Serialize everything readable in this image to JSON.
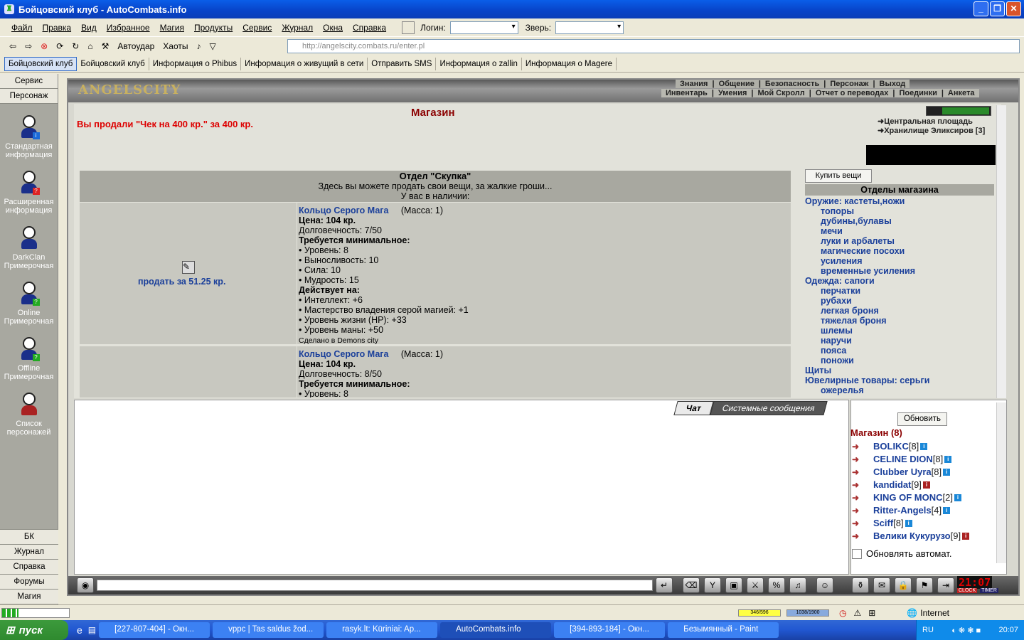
{
  "window": {
    "title": "Бойцовский клуб - AutoCombats.info"
  },
  "menu": [
    "Файл",
    "Правка",
    "Вид",
    "Избранное",
    "Магия",
    "Продукты",
    "Сервис",
    "Журнал",
    "Окна",
    "Справка"
  ],
  "menu_fields": {
    "login_label": "Логин:",
    "pet_label": "Зверь:"
  },
  "toolbar": {
    "autostrike": "Автоудар",
    "chaots": "Хаоты",
    "address": "http://angelscity.combats.ru/enter.pl"
  },
  "favorites": [
    "Бойцовский клуб",
    "Бойцовский клуб",
    "Информация о Phibus",
    "Информация о живущий в сети",
    "Отправить SMS",
    "Информация о zallin",
    "Информация о Magere"
  ],
  "left_panel": {
    "top": [
      "Сервис",
      "Персонаж"
    ],
    "items": [
      "Стандартная информация",
      "Расширенная информация",
      "DarkClan Примерочная",
      "Online Примерочная",
      "Offline Примерочная",
      "Список персонажей"
    ],
    "bottom": [
      "БК",
      "Журнал",
      "Справка",
      "Форумы",
      "Магия"
    ]
  },
  "game": {
    "logo": "ANGELSCITY",
    "nav_row1": [
      "Знания",
      "Общение",
      "Безопасность",
      "Персонаж",
      "Выход"
    ],
    "nav_row2": [
      "Инвентарь",
      "Умения",
      "Мой Скролл",
      "Отчет о переводах",
      "Поединки",
      "Анкета"
    ]
  },
  "shop": {
    "title": "Магазин",
    "sold_msg": "Вы продали \"Чек на 400 кр.\" за 400 кр.",
    "dept_title": "Отдел \"Скупка\"",
    "dept_desc": "Здесь вы можете продать свои вещи, за жалкие гроши...",
    "dept_have": "У вас в наличии:",
    "items": [
      {
        "name": "Кольцо Серого Мага",
        "mass": "(Масса: 1)",
        "price": "Цена: 104 кр.",
        "durability": "Долговечность: 7/50",
        "req_title": "Требуется минимальное:",
        "reqs": [
          "• Уровень: 8",
          "• Выносливость: 10",
          "• Сила: 10",
          "• Мудрость: 15"
        ],
        "acts_title": "Действует на:",
        "acts": [
          "• Интеллект: +6",
          "• Мастерство владения серой магией: +1",
          "• Уровень жизни (HP): +33",
          "• Уровень маны: +50"
        ],
        "made": "Сделано в Demons city",
        "sell": "продать за 51.25 кр."
      },
      {
        "name": "Кольцо Серого Мага",
        "mass": "(Масса: 1)",
        "price": "Цена: 104 кр.",
        "durability": "Долговечность: 8/50",
        "req_title": "Требуется минимальное:",
        "reqs": [
          "• Уровень: 8"
        ]
      }
    ]
  },
  "right": {
    "links": [
      "Центральная площадь",
      "Хранилище Эликсиров [3]"
    ],
    "buy_btn": "Купить вещи",
    "dept_head": "Отделы магазина",
    "cats": [
      {
        "t": "Оружие: кастеты,ножи",
        "s": 0
      },
      {
        "t": "топоры",
        "s": 1
      },
      {
        "t": "дубины,булавы",
        "s": 1
      },
      {
        "t": "мечи",
        "s": 1
      },
      {
        "t": "луки и арбалеты",
        "s": 1
      },
      {
        "t": "магические посохи",
        "s": 1
      },
      {
        "t": "усиления",
        "s": 1
      },
      {
        "t": "временные усиления",
        "s": 1
      },
      {
        "t": "Одежда: сапоги",
        "s": 0
      },
      {
        "t": "перчатки",
        "s": 1
      },
      {
        "t": "рубахи",
        "s": 1
      },
      {
        "t": "легкая броня",
        "s": 1
      },
      {
        "t": "тяжелая броня",
        "s": 1
      },
      {
        "t": "шлемы",
        "s": 1
      },
      {
        "t": "наручи",
        "s": 1
      },
      {
        "t": "пояса",
        "s": 1
      },
      {
        "t": "поножи",
        "s": 1
      },
      {
        "t": "Щиты",
        "s": 0
      },
      {
        "t": "Ювелирные товары: серьги",
        "s": 0
      },
      {
        "t": "ожерелья",
        "s": 1
      }
    ]
  },
  "chat": {
    "tabs": [
      "Чат",
      "Системные сообщения"
    ]
  },
  "online": {
    "refresh": "Обновить",
    "title": "Магазин (8)",
    "users": [
      {
        "n": "BOLIKC",
        "l": "[8]",
        "c": "blue"
      },
      {
        "n": "CELINE DION",
        "l": "[8]",
        "c": "purple"
      },
      {
        "n": "Clubber Uyra",
        "l": "[8]",
        "c": "blue"
      },
      {
        "n": "kandidat",
        "l": "[9]",
        "c": "red"
      },
      {
        "n": "KING OF MONC",
        "l": "[2]",
        "c": "blue"
      },
      {
        "n": "Ritter-Angels",
        "l": "[4]",
        "c": "blue"
      },
      {
        "n": "Sciff",
        "l": "[8]",
        "c": "blue"
      },
      {
        "n": "Велики Кукурузо",
        "l": "[9]",
        "c": "red"
      }
    ],
    "auto": "Обновлять автомат."
  },
  "clock": "21:07",
  "clock_labels": [
    "CLOCK",
    "TIMER"
  ],
  "status": {
    "hp": "346/596",
    "mana": "1038/1900",
    "zone": "Internet"
  },
  "taskbar": {
    "start": "пуск",
    "tasks": [
      "[227-807-404] - Окн...",
      "vppc | Tas saldus žod...",
      "rasyk.lt: Kūriniai: Ap...",
      "AutoCombats.info",
      "[394-893-184] - Окн...",
      "Безымянный - Paint"
    ],
    "lang": "RU",
    "time": "20:07"
  }
}
